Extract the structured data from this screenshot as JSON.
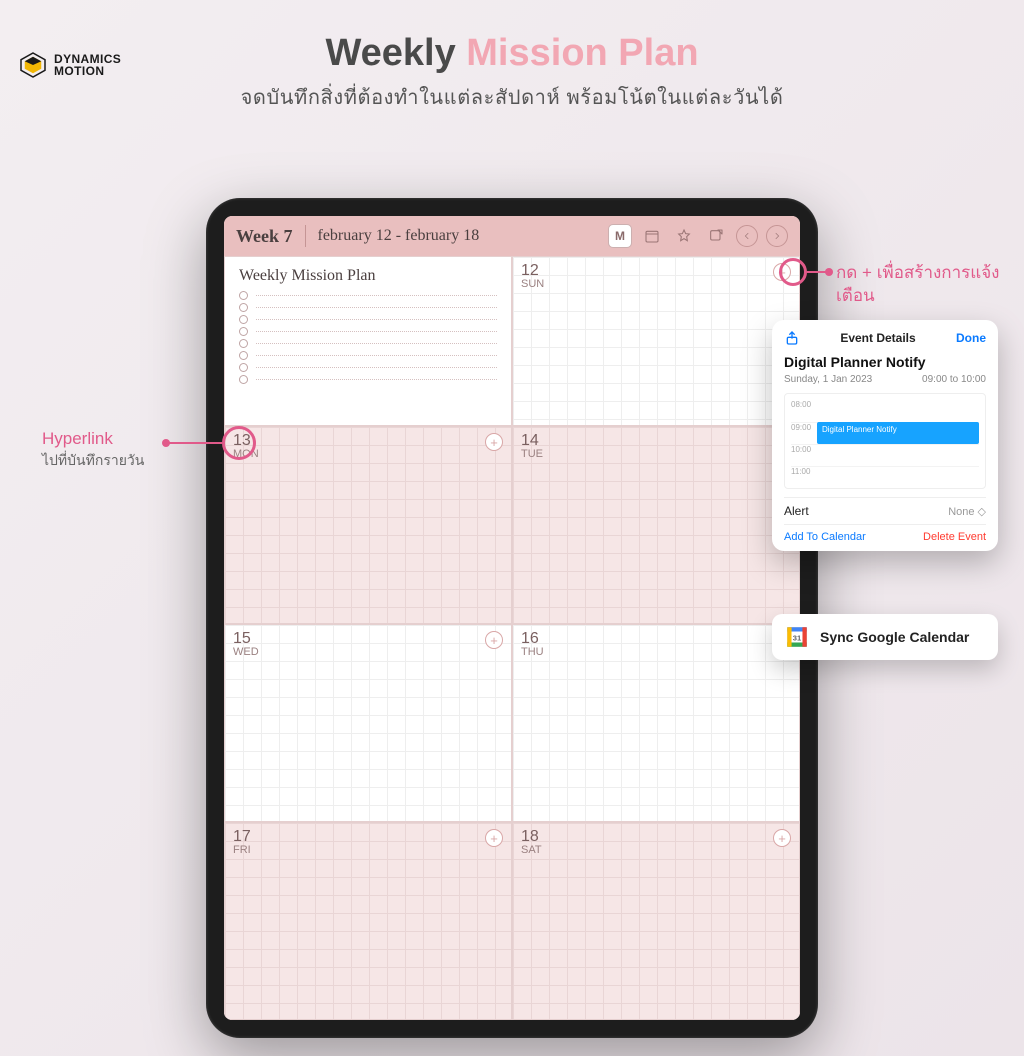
{
  "brand": {
    "line1": "DYNAMICS",
    "line2": "MOTION"
  },
  "hero": {
    "title_prefix": "Weekly ",
    "title_accent": "Mission Plan",
    "subtitle": "จดบันทึกสิ่งที่ต้องทำในแต่ละสัปดาห์ พร้อมโน้ตในแต่ละวันได้"
  },
  "planner": {
    "week_label": "Week 7",
    "range_from": "february 12",
    "range_to": "february 18",
    "range_sep": " - ",
    "month_btn": "M",
    "mission_title": "Weekly Mission Plan",
    "days": [
      {
        "num": "12",
        "dow": "SUN"
      },
      {
        "num": "13",
        "dow": "MON"
      },
      {
        "num": "14",
        "dow": "TUE"
      },
      {
        "num": "15",
        "dow": "WED"
      },
      {
        "num": "16",
        "dow": "THU"
      },
      {
        "num": "17",
        "dow": "FRI"
      },
      {
        "num": "18",
        "dow": "SAT"
      }
    ]
  },
  "callouts": {
    "add_reminder": "กด + เพื่อสร้างการแจ้งเตือน",
    "hyperlink_title": "Hyperlink",
    "hyperlink_sub": "ไปที่บันทึกรายวัน"
  },
  "popup": {
    "header_title": "Event Details",
    "done": "Done",
    "event_name": "Digital Planner Notify",
    "date": "Sunday, 1 Jan 2023",
    "time_range": "09:00 to 10:00",
    "slots": [
      "08:00",
      "09:00",
      "10:00",
      "11:00"
    ],
    "block_label": "Digital Planner Notify",
    "alert_label": "Alert",
    "alert_value": "None ◇",
    "add": "Add To Calendar",
    "delete": "Delete Event"
  },
  "gcal": {
    "label": "Sync Google Calendar",
    "day": "31"
  }
}
